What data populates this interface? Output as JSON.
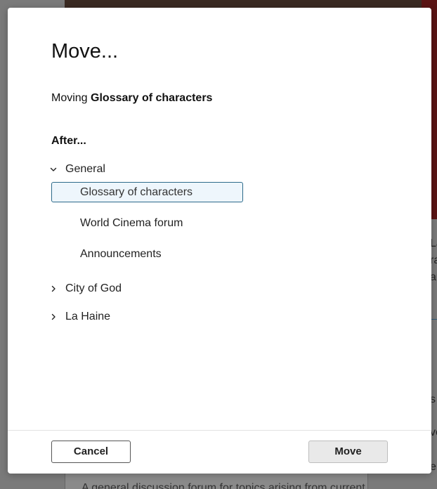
{
  "background": {
    "side_text": [
      "La",
      "ra",
      "au",
      "s",
      "ve",
      "e"
    ],
    "bottom_text": "A general discussion forum for topics arising from current"
  },
  "dialog": {
    "title": "Move...",
    "moving_prefix": "Moving",
    "moving_item": "Glossary of characters",
    "after_label": "After...",
    "tree": {
      "groups": [
        {
          "label": "General",
          "expanded": true,
          "items": [
            {
              "label": "Glossary of characters",
              "selected": true
            },
            {
              "label": "World Cinema forum",
              "selected": false
            },
            {
              "label": "Announcements",
              "selected": false
            }
          ]
        },
        {
          "label": "City of God",
          "expanded": false
        },
        {
          "label": "La Haine",
          "expanded": false
        }
      ]
    },
    "buttons": {
      "cancel": "Cancel",
      "move": "Move"
    }
  },
  "colors": {
    "selected_border": "#2c6a8a",
    "selected_bg": "#eef6fc",
    "move_button_bg": "#e9e9e9"
  },
  "icons": {
    "expanded": "chevron-down-icon",
    "collapsed": "chevron-right-icon"
  }
}
